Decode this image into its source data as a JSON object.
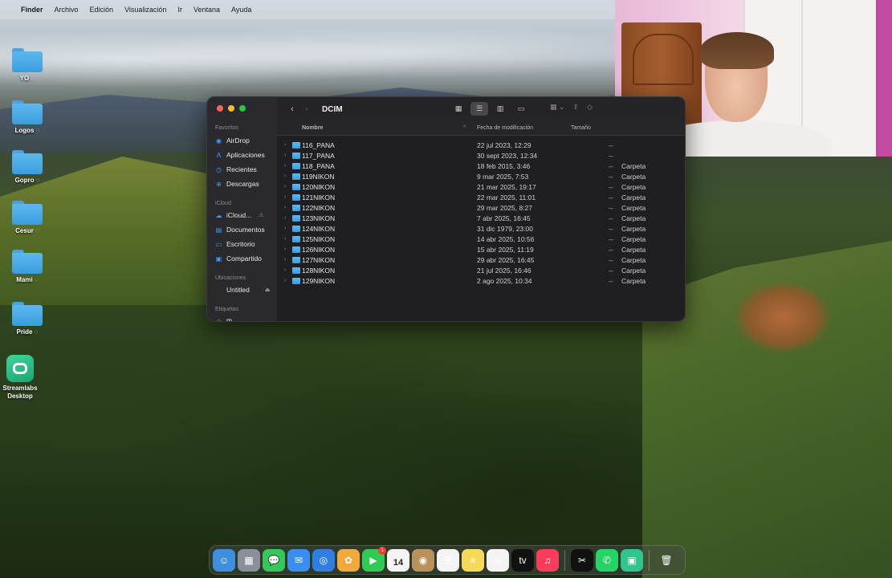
{
  "menubar": {
    "apple": "",
    "app": "Finder",
    "items": [
      "Archivo",
      "Edición",
      "Visualización",
      "Ir",
      "Ventana",
      "Ayuda"
    ]
  },
  "desktop": {
    "icons": [
      {
        "label": "YO",
        "icon": "folder-icon"
      },
      {
        "label": "Logos",
        "icon": "folder-icon"
      },
      {
        "label": "Gopro",
        "icon": "folder-icon"
      },
      {
        "label": "Cesur",
        "icon": "folder-icon"
      },
      {
        "label": "Mami",
        "icon": "folder-icon"
      },
      {
        "label": "Pride",
        "icon": "folder-icon"
      }
    ],
    "app": {
      "label_line1": "Streamlabs",
      "label_line2": "Desktop",
      "icon": "streamlabs-icon"
    }
  },
  "finder": {
    "title": "DCIM",
    "sidebar": {
      "favorites_header": "Favoritos",
      "favorites": [
        {
          "label": "AirDrop",
          "icon": "airdrop-icon"
        },
        {
          "label": "Aplicaciones",
          "icon": "applications-icon"
        },
        {
          "label": "Recientes",
          "icon": "recents-icon"
        },
        {
          "label": "Descargas",
          "icon": "downloads-icon"
        }
      ],
      "icloud_header": "iCloud",
      "icloud": [
        {
          "label": "iCloud...",
          "icon": "icloud-icon",
          "extra": "⚠"
        },
        {
          "label": "Documentos",
          "icon": "documents-icon"
        },
        {
          "label": "Escritorio",
          "icon": "desktop-icon"
        },
        {
          "label": "Compartido",
          "icon": "shared-icon"
        }
      ],
      "locations_header": "Ubicaciones",
      "locations": [
        {
          "label": "Untitled",
          "icon": "disk-icon",
          "extra": "⏏"
        }
      ],
      "tags_header": "Etiquetas",
      "tags_item": "m"
    },
    "columns": {
      "name": "Nombre",
      "date": "Fecha de modificación",
      "size": "Tamaño"
    },
    "rows": [
      {
        "name": "116_PANA",
        "date": "22 jul 2023, 12:29",
        "size": "--",
        "kind": ""
      },
      {
        "name": "117_PANA",
        "date": "30 sept 2023, 12:34",
        "size": "--",
        "kind": ""
      },
      {
        "name": "118_PANA",
        "date": "18 feb 2015, 3:46",
        "size": "--",
        "kind": "Carpeta"
      },
      {
        "name": "119NIKON",
        "date": "9 mar 2025, 7:53",
        "size": "--",
        "kind": "Carpeta"
      },
      {
        "name": "120NIKON",
        "date": "21 mar 2025, 19:17",
        "size": "--",
        "kind": "Carpeta"
      },
      {
        "name": "121NIKON",
        "date": "22 mar 2025, 11:01",
        "size": "--",
        "kind": "Carpeta"
      },
      {
        "name": "122NIKON",
        "date": "29 mar 2025, 8:27",
        "size": "--",
        "kind": "Carpeta"
      },
      {
        "name": "123NIKON",
        "date": "7 abr 2025, 16:45",
        "size": "--",
        "kind": "Carpeta"
      },
      {
        "name": "124NIKON",
        "date": "31 dic 1979, 23:00",
        "size": "--",
        "kind": "Carpeta"
      },
      {
        "name": "125NIKON",
        "date": "14 abr 2025, 10:56",
        "size": "--",
        "kind": "Carpeta"
      },
      {
        "name": "126NIKON",
        "date": "15 abr 2025, 11:19",
        "size": "--",
        "kind": "Carpeta"
      },
      {
        "name": "127NIKON",
        "date": "29 abr 2025, 16:45",
        "size": "--",
        "kind": "Carpeta"
      },
      {
        "name": "128NIKON",
        "date": "21 jul 2025, 16:46",
        "size": "--",
        "kind": "Carpeta"
      },
      {
        "name": "129NIKON",
        "date": "2 ago 2025, 10:34",
        "size": "--",
        "kind": "Carpeta"
      }
    ]
  },
  "dock": {
    "apps": [
      {
        "name": "finder-icon",
        "color": "#3d8fe0",
        "glyph": "☺"
      },
      {
        "name": "launchpad-icon",
        "color": "#8a8f99",
        "glyph": "▦"
      },
      {
        "name": "messages-icon",
        "color": "#34c759",
        "glyph": "💬"
      },
      {
        "name": "mail-icon",
        "color": "#3a8ef0",
        "glyph": "✉"
      },
      {
        "name": "safari-icon",
        "color": "#2f7fe0",
        "glyph": "◎"
      },
      {
        "name": "photos-icon",
        "color": "#f2a93b",
        "glyph": "✿"
      },
      {
        "name": "facetime-icon",
        "color": "#2ecc55",
        "glyph": "▶",
        "badge": "1"
      },
      {
        "name": "calendar-icon",
        "color": "#f4f4f4",
        "glyph": "",
        "calendar_day": "14"
      },
      {
        "name": "contacts-icon",
        "color": "#b8925a",
        "glyph": "◉"
      },
      {
        "name": "reminders-icon",
        "color": "#f4f4f4",
        "glyph": "☰"
      },
      {
        "name": "notes-icon",
        "color": "#f7d95a",
        "glyph": "≡"
      },
      {
        "name": "freeform-icon",
        "color": "#f4f4f4",
        "glyph": "∿"
      },
      {
        "name": "appletv-icon",
        "color": "#111111",
        "glyph": "tv"
      },
      {
        "name": "music-icon",
        "color": "#fa3c5a",
        "glyph": "♫"
      }
    ],
    "apps_right": [
      {
        "name": "capcut-icon",
        "color": "#111111",
        "glyph": "✂"
      },
      {
        "name": "whatsapp-icon",
        "color": "#25d366",
        "glyph": "✆"
      },
      {
        "name": "streamlabs-dock-icon",
        "color": "#31c48d",
        "glyph": "▣"
      }
    ],
    "trash": {
      "name": "trash-icon",
      "glyph": "🗑"
    }
  }
}
